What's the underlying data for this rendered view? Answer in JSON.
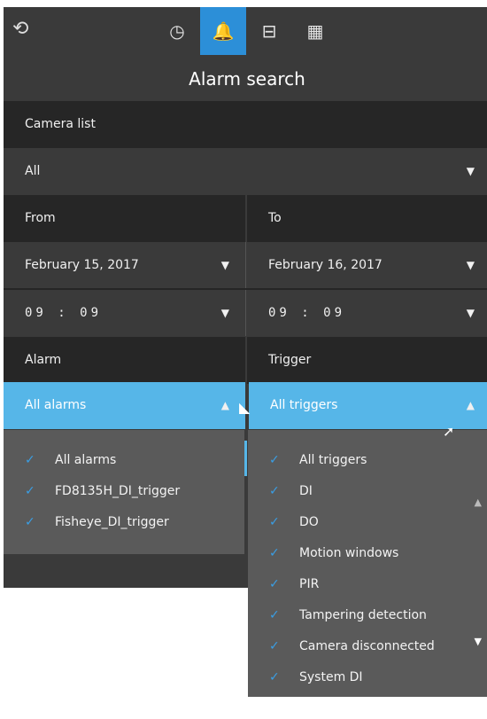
{
  "toolbar": {
    "back_icon": "back-rotate-icon",
    "tabs": [
      {
        "icon": "clock-icon",
        "glyph": "◷"
      },
      {
        "icon": "bell-icon",
        "glyph": "🔔"
      },
      {
        "icon": "scanner-icon",
        "glyph": "⊟"
      },
      {
        "icon": "grid-icon",
        "glyph": "▦"
      }
    ]
  },
  "title": "Alarm search",
  "camera": {
    "label": "Camera list",
    "value": "All"
  },
  "from": {
    "label": "From",
    "date": "February 15, 2017",
    "time": "09 : 09"
  },
  "to": {
    "label": "To",
    "date": "February 16, 2017",
    "time": "09 : 09"
  },
  "alarm": {
    "label": "Alarm",
    "selected": "All alarms",
    "options": [
      "All alarms",
      "FD8135H_DI_trigger",
      "Fisheye_DI_trigger"
    ]
  },
  "trigger": {
    "label": "Trigger",
    "selected": "All triggers",
    "options": [
      "All triggers",
      "DI",
      "DO",
      "Motion windows",
      "PIR",
      "Tampering detection",
      "Camera disconnected",
      "System DI"
    ]
  },
  "colors": {
    "accent": "#2c8fd8",
    "selected": "#56b6e8",
    "panel": "#3a3a3a",
    "header": "#262626"
  }
}
